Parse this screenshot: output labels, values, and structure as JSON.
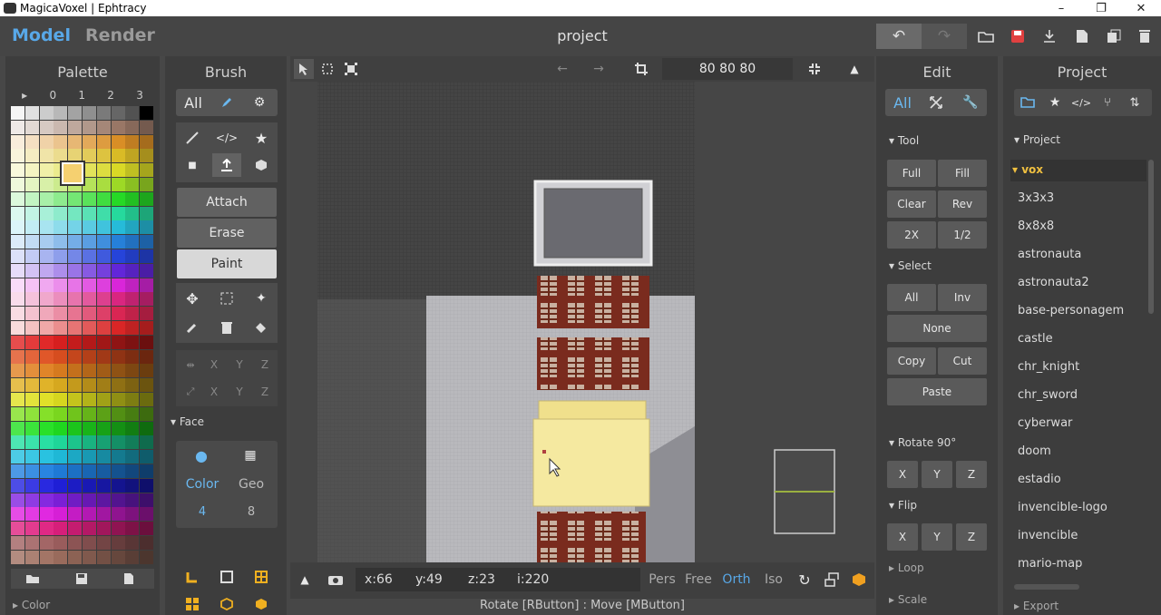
{
  "window": {
    "title": "MagicaVoxel | Ephtracy",
    "minimize": "–",
    "maximize": "❐",
    "close": "✕"
  },
  "header": {
    "tabs": [
      {
        "label": "Model"
      },
      {
        "label": "Render"
      }
    ],
    "project_title": "project"
  },
  "palette": {
    "title": "Palette",
    "pages": [
      "▸",
      "0",
      "1",
      "2",
      "3"
    ],
    "footer_label": "▸ Color",
    "accent": "#58a8e8"
  },
  "brush": {
    "title": "Brush",
    "mode_all": "All",
    "actions": [
      "Attach",
      "Erase",
      "Paint"
    ],
    "axis_labels": [
      "X",
      "Y",
      "Z",
      "X",
      "Y",
      "Z"
    ],
    "face": {
      "title": "▾ Face",
      "color_label": "Color",
      "geo_label": "Geo",
      "color_value": "4",
      "geo_value": "8"
    }
  },
  "viewport_toolbar": {
    "size": "80  80  80"
  },
  "viewport_status": {
    "x": "x:66",
    "y": "y:49",
    "z": "z:23",
    "i": "i:220",
    "views": [
      "Pers",
      "Free",
      "Orth",
      "Iso"
    ],
    "active_view": "Orth",
    "help": "Rotate [RButton] : Move [MButton]"
  },
  "edit": {
    "title": "Edit",
    "mode_all": "All",
    "tool": {
      "title": "▾ Tool",
      "buttons": [
        "Full",
        "Fill",
        "Clear",
        "Rev",
        "2X",
        "1/2"
      ]
    },
    "select": {
      "title": "▾ Select",
      "all": "All",
      "inv": "Inv",
      "none": "None",
      "copy": "Copy",
      "cut": "Cut",
      "paste": "Paste"
    },
    "rotate": {
      "title": "▾ Rotate 90°",
      "axes": [
        "X",
        "Y",
        "Z"
      ]
    },
    "flip": {
      "title": "▾ Flip",
      "axes": [
        "X",
        "Y",
        "Z"
      ]
    },
    "loop": "▸ Loop",
    "scale": "▸ Scale"
  },
  "project": {
    "title": "Project",
    "section": "▾ Project",
    "folder": "▾ vox",
    "folder_color": "#f0c040",
    "items": [
      "3x3x3",
      "8x8x8",
      "astronauta",
      "astronauta2",
      "base-personagem",
      "castle",
      "chr_knight",
      "chr_sword",
      "cyberwar",
      "doom",
      "estadio",
      "invencible-logo",
      "invencible",
      "mario-map"
    ],
    "export": "▸ Export"
  }
}
